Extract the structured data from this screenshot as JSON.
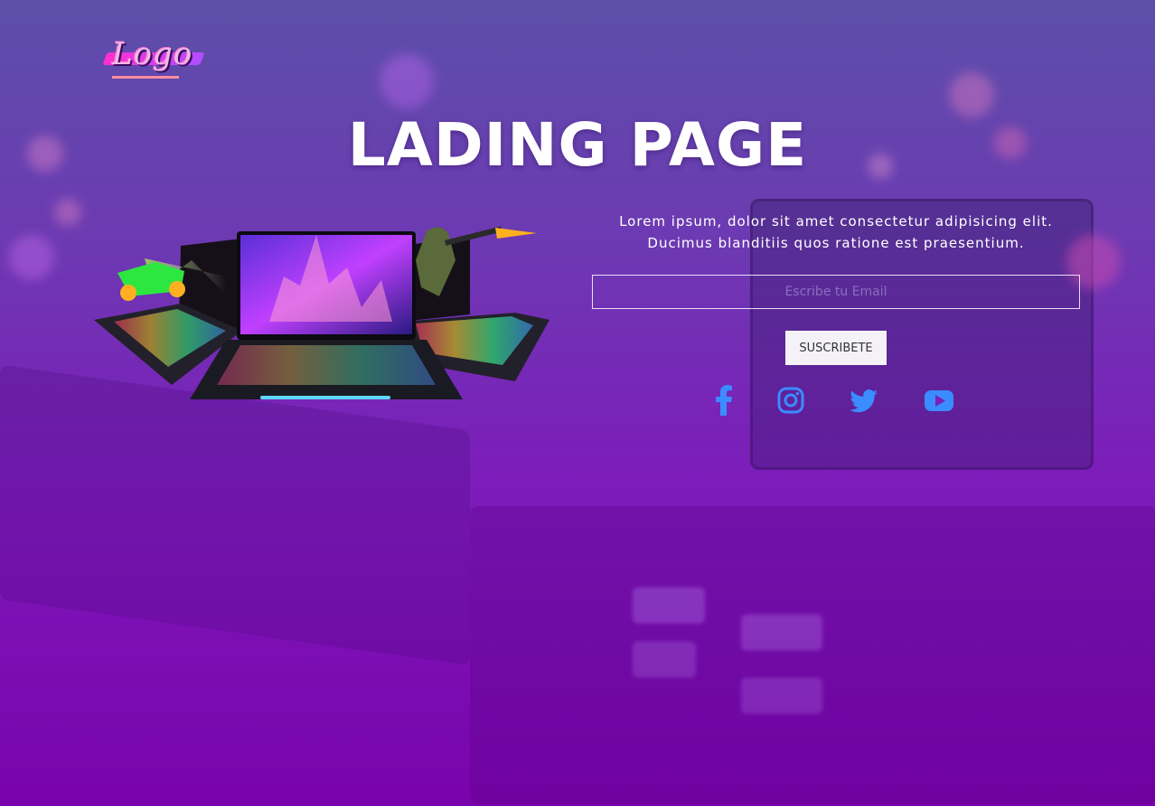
{
  "logo": {
    "text": "Logo"
  },
  "hero": {
    "title": "LADING PAGE",
    "description_line1": "Lorem ipsum, dolor sit amet consectetur adipisicing elit.",
    "description_line2": "Ducimus blanditiis quos ratione est praesentium."
  },
  "subscribe": {
    "email_placeholder": "Escribe tu Email",
    "email_value": "",
    "button_label": "SUSCRIBETE"
  },
  "social": {
    "items": [
      {
        "icon": "facebook-icon"
      },
      {
        "icon": "instagram-icon"
      },
      {
        "icon": "twitter-icon"
      },
      {
        "icon": "youtube-icon"
      }
    ],
    "color": "#3a8cff"
  },
  "colors": {
    "background_top": "#5a4fa8",
    "background_bottom": "#7a08b0",
    "text": "#ffffff",
    "button_bg": "#f4f2f6"
  }
}
